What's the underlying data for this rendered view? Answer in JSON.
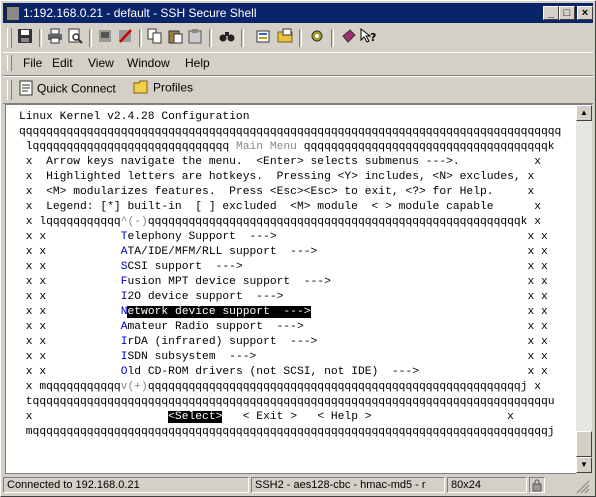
{
  "window": {
    "title": "1:192.168.0.21 - default - SSH Secure Shell",
    "minimize_glyph": "_",
    "maximize_glyph": "□",
    "close_glyph": "×"
  },
  "toolbar": {
    "icons": [
      "save-icon",
      "print-icon",
      "print-preview-icon",
      "new-terminal-icon",
      "disconnect-icon",
      "copy-icon",
      "paste-icon",
      "paste-alt-icon",
      "find-icon",
      "settings-icon",
      "file-transfer-icon",
      "key-icon",
      "help-icon"
    ]
  },
  "menubar": {
    "file": "File",
    "edit": "Edit",
    "view": "View",
    "window": "Window",
    "help": "Help"
  },
  "quickbar": {
    "quick_connect": "Quick Connect",
    "profiles": "Profiles"
  },
  "terminal": {
    "l01": "Linux Kernel v2.4.28 Configuration",
    "l02": "qqqqqqqqqqqqqqqqqqqqqqqqqqqqqqqqqqqqqqqqqqqqqqqqqqqqqqqqqqqqqqqqqqqqqqqqqqqqqqqq",
    "l03a": " lqqqqqqqqqqqqqqqqqqqqqqqqqqqqq ",
    "l03b": "Main Menu",
    "l03c": " qqqqqqqqqqqqqqqqqqqqqqqqqqqqqqqqqqqqk",
    "l04": " x  Arrow keys navigate the menu.  <Enter> selects submenus --->.           x",
    "l05": " x  Highlighted letters are hotkeys.  Pressing <Y> includes, <N> excludes, x",
    "l06": " x  <M> modularizes features.  Press <Esc><Esc> to exit, <?> for Help.     x",
    "l07": " x  Legend: [*] built-in  [ ] excluded  <M> module  < > module capable      x",
    "l08a": " x lqqqqqqqqqqq",
    "l08b": "^(-)",
    "l08c": "qqqqqqqqqqqqqqqqqqqqqqqqqqqqqqqqqqqqqqqqqqqqqqqqqqqqqqqk x",
    "items": [
      "Telephony Support  --->",
      "ATA/IDE/MFM/RLL support  --->",
      "SCSI support  --->",
      "Fusion MPT device support  --->",
      "I2O device support  --->",
      "Network device support  --->",
      "Amateur Radio support  --->",
      "IrDA (infrared) support  --->",
      "ISDN subsystem  --->",
      "Old CD-ROM drivers (not SCSI, not IDE)  --->"
    ],
    "item_prefix": " x x           ",
    "item_suffix": "x x",
    "l19a": " x mqqqqqqqqqqq",
    "l19b": "v(+)",
    "l19c": "qqqqqqqqqqqqqqqqqqqqqqqqqqqqqqqqqqqqqqqqqqqqqqqqqqqqqqqj x",
    "l20": " tqqqqqqqqqqqqqqqqqqqqqqqqqqqqqqqqqqqqqqqqqqqqqqqqqqqqqqqqqqqqqqqqqqqqqqqqqqqqu",
    "l21_pre": " x                    ",
    "select": "<Select>",
    "exit": "< Exit >",
    "help": "< Help >",
    "l22": " mqqqqqqqqqqqqqqqqqqqqqqqqqqqqqqqqqqqqqqqqqqqqqqqqqqqqqqqqqqqqqqqqqqqqqqqqqqqqj",
    "selected_index": 5
  },
  "status": {
    "connection": "Connected to 192.168.0.21",
    "cipher": "SSH2 - aes128-cbc - hmac-md5 - r",
    "size": "80x24"
  }
}
